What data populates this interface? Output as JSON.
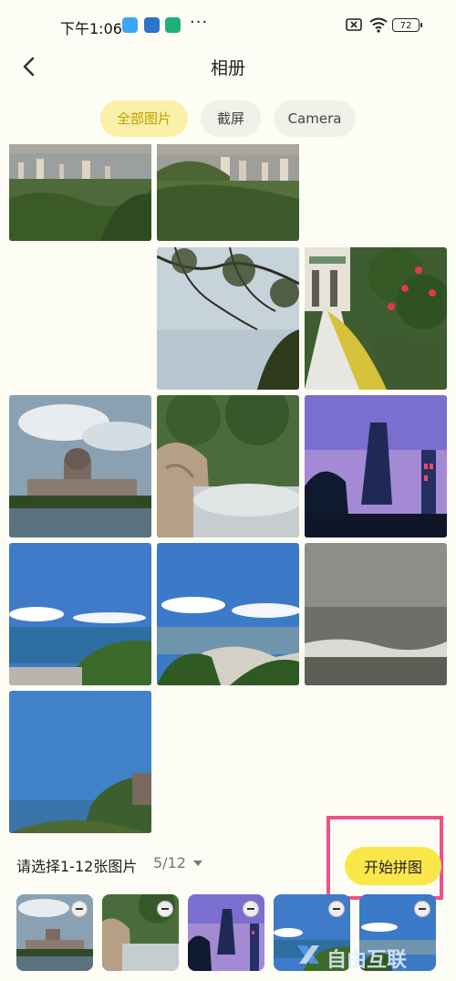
{
  "status_bar": {
    "time": "下午1:06",
    "more": "···",
    "battery": "72",
    "icons": [
      "cloud-icon",
      "person-icon",
      "app-icon",
      "no-sim-icon",
      "wifi-icon",
      "battery-icon"
    ]
  },
  "header": {
    "title": "相册",
    "back_icon": "back-arrow-icon"
  },
  "tabs": [
    {
      "label": "全部图片",
      "active": true
    },
    {
      "label": "截屏",
      "active": false
    },
    {
      "label": "Camera",
      "active": false
    }
  ],
  "grid": {
    "photos": [
      "city-view-1",
      "city-view-2",
      "tree-branches",
      "garden-path",
      "palace-lake",
      "waterfall-rocks",
      "tower-night",
      "bay-coast-1",
      "bay-coast-2",
      "sea-waves",
      "sea-cliff"
    ]
  },
  "footer": {
    "select_hint": "请选择1-12张图片",
    "count": "5/12",
    "start_button": "开始拼图"
  },
  "selected_thumbs": [
    "palace-lake",
    "waterfall-rocks",
    "tower-night",
    "bay-coast-1",
    "bay-coast-2"
  ],
  "watermark": "自由互联",
  "colors": {
    "accent": "#fbe749",
    "tab_active_bg": "#fbf0a8",
    "tab_active_text": "#c19e00",
    "highlight": "#f0508a",
    "background": "#fdfdf5"
  }
}
